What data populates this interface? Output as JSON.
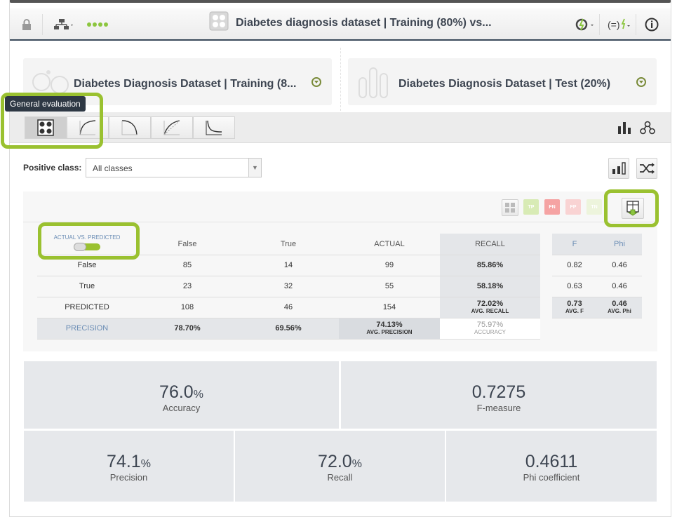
{
  "header": {
    "title": "Diabetes diagnosis dataset | Training (80%) vs...",
    "icons": [
      "lock-icon",
      "tree-icon",
      "dots-icon",
      "model-icon",
      "refresh-icon",
      "formula-icon",
      "info-icon"
    ]
  },
  "cards": [
    {
      "title": "Diabetes Diagnosis Dataset | Training (8..."
    },
    {
      "title": "Diabetes Diagnosis Dataset | Test (20%)"
    }
  ],
  "tooltip": "General evaluation",
  "positive_class": {
    "label": "Positive class:",
    "selected": "All classes"
  },
  "chips": [
    "TP",
    "FN",
    "FP",
    "TN"
  ],
  "colors": {
    "accent": "#9ac130",
    "dark": "#3d4551",
    "tp": "#c9e39a",
    "fn": "#f08f8f",
    "fp": "#f6bfbf",
    "tn": "#e4efc9"
  },
  "matrix": {
    "toggle_label": "ACTUAL VS. PREDICTED",
    "headers": [
      "False",
      "True",
      "ACTUAL",
      "RECALL"
    ],
    "rows": [
      {
        "label": "False",
        "c1": "85",
        "c2": "14",
        "actual": "99",
        "recall": "85.86%"
      },
      {
        "label": "True",
        "c1": "23",
        "c2": "32",
        "actual": "55",
        "recall": "58.18%"
      },
      {
        "label": "PREDICTED",
        "c1": "108",
        "c2": "46",
        "actual": "154",
        "recall": "72.02%",
        "recall_sub": "AVG. RECALL"
      }
    ],
    "precision_row": {
      "label": "PRECISION",
      "c1": "78.70%",
      "c2": "69.56%",
      "actual": "74.13%",
      "actual_sub": "AVG. PRECISION",
      "recall": "75.97%",
      "recall_sub": "ACCURACY"
    }
  },
  "fphi": {
    "headers": [
      "F",
      "Phi"
    ],
    "rows": [
      [
        "0.82",
        "0.46"
      ],
      [
        "0.63",
        "0.46"
      ]
    ],
    "avg": {
      "f": "0.73",
      "f_sub": "AVG. F",
      "phi": "0.46",
      "phi_sub": "AVG. Phi"
    }
  },
  "metrics": {
    "accuracy": {
      "value": "76.0",
      "unit": "%",
      "label": "Accuracy"
    },
    "fmeasure": {
      "value": "0.7275",
      "unit": "",
      "label": "F-measure"
    },
    "precision": {
      "value": "74.1",
      "unit": "%",
      "label": "Precision"
    },
    "recall": {
      "value": "72.0",
      "unit": "%",
      "label": "Recall"
    },
    "phi": {
      "value": "0.4611",
      "unit": "",
      "label": "Phi coefficient"
    }
  }
}
